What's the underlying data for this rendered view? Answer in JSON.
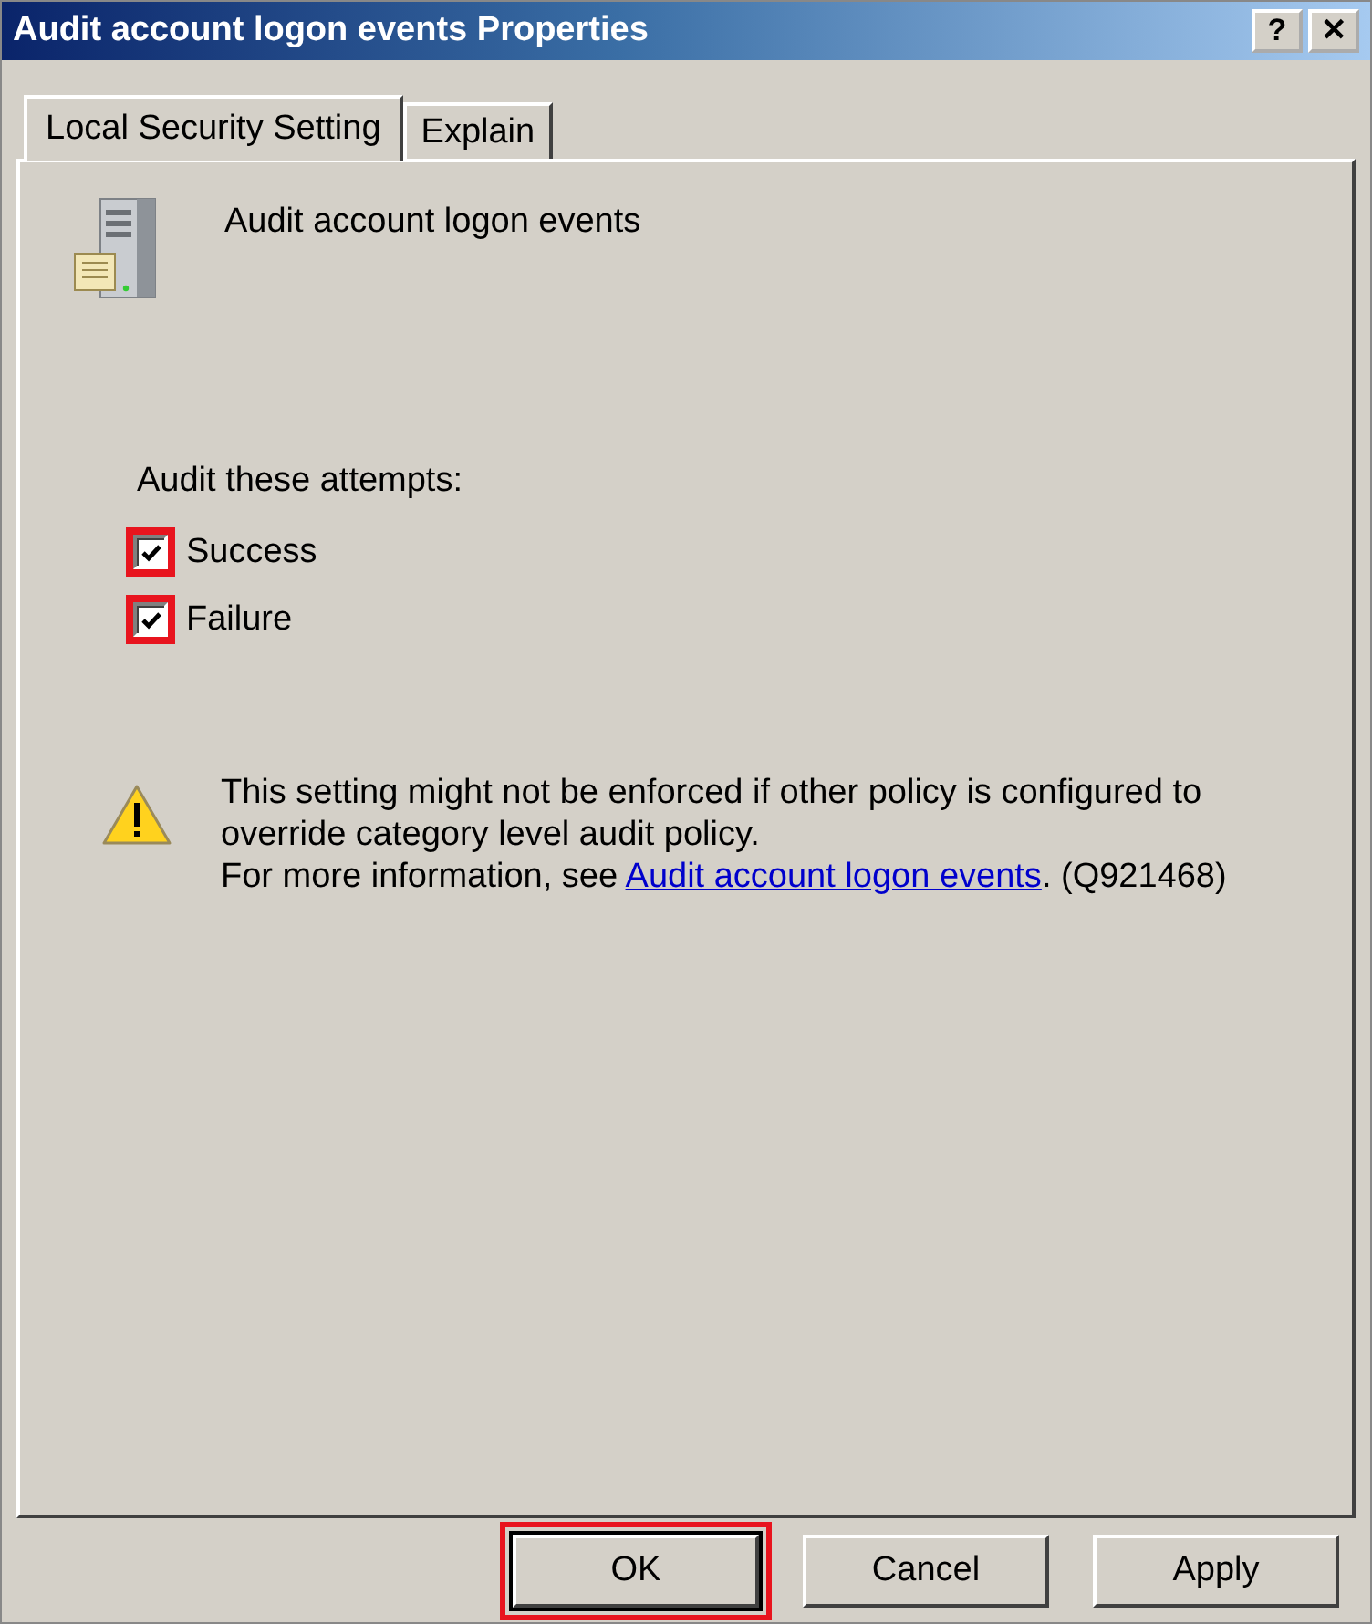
{
  "window": {
    "title": "Audit account logon events Properties",
    "title_buttons": [
      "?",
      "✕"
    ]
  },
  "tabs": [
    {
      "label": "Local Security Setting",
      "selected": true
    },
    {
      "label": "Explain",
      "selected": false
    }
  ],
  "policy_name": "Audit account logon events",
  "group_label": "Audit these attempts:",
  "checkboxes": [
    {
      "label": "Success",
      "checked": true,
      "highlighted": true
    },
    {
      "label": "Failure",
      "checked": true,
      "highlighted": true
    }
  ],
  "warning": {
    "lines": [
      "This setting might not be enforced if other policy is configured to",
      "override category level audit policy."
    ],
    "info_prefix": "For more information, see ",
    "link": "Audit account logon events",
    "info_suffix": ". (Q921468)"
  },
  "buttons": [
    {
      "label": "OK",
      "default": true,
      "highlighted": true
    },
    {
      "label": "Cancel",
      "default": false,
      "highlighted": false
    },
    {
      "label": "Apply",
      "default": false,
      "highlighted": false
    }
  ]
}
